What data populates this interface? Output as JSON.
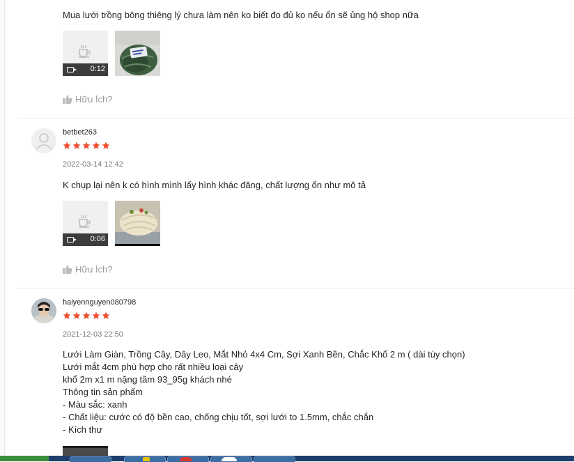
{
  "reviews": [
    {
      "comment": "Mua lưới trồng bông thiêng lý chưa làm nên ko biết đo đủ ko nếu ổn sẽ ủng hộ shop nữa",
      "video_duration": "0:12",
      "photo_label": "",
      "helpful_label": "Hữu Ích?"
    },
    {
      "username": "betbet263",
      "rating": 5,
      "timestamp": "2022-03-14 12:42",
      "comment": "K chụp lại nên k có hình mình lấy hình khác đăng, chất lượng ổn như mô tả",
      "video_duration": "0:06",
      "helpful_label": "Hữu Ích?"
    },
    {
      "username": "haiyennguyen080798",
      "rating": 5,
      "timestamp": "2021-12-03 22:50",
      "comment_lines": [
        "Lưới Làm Giàn, Trồng Cây, Dây Leo, Mắt Nhỏ 4x4 Cm, Sợi Xanh Bền, Chắc Khổ 2 m ( dài tùy chọn)",
        "Lưới mắt 4cm phù hợp cho rất nhiều loại cây",
        "khổ 2m x1 m  nặng tầm 93_95g khách nhé",
        "Thông tin sản phẩm",
        "- Màu sắc: xanh",
        "- Chất liệu: cước có độ bền cao, chống chịu tốt, sợi lưới to 1.5mm, chắc chắn",
        "- Kích thư"
      ]
    }
  ],
  "icons": {
    "star": "star-icon",
    "thumb": "thumbs-up-icon",
    "video": "video-camera-icon",
    "placeholder": "coffee-cup-icon"
  },
  "colors": {
    "star": "#ee4d2d",
    "helpful": "#9e9e9e",
    "divider": "#e8e8e8"
  }
}
